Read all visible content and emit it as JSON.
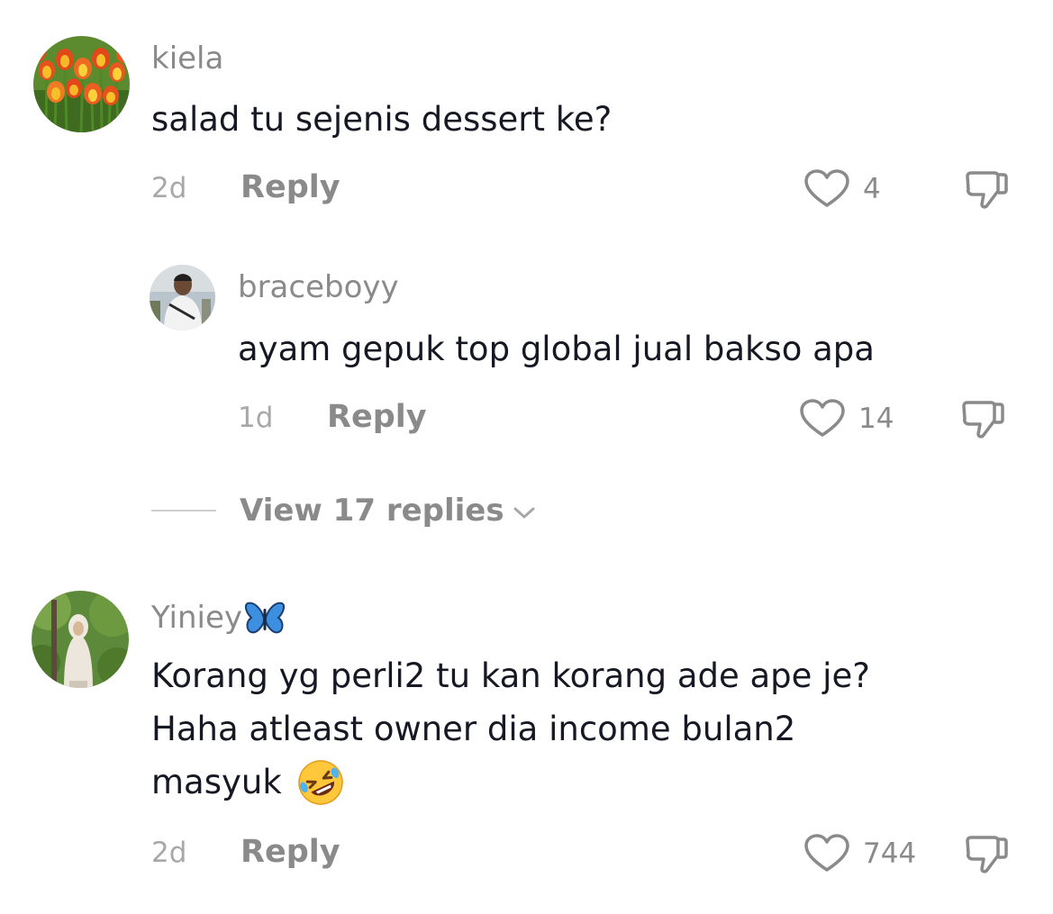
{
  "comments": [
    {
      "username": "kiela",
      "text": "salad tu sejenis dessert ke?",
      "time": "2d",
      "reply_label": "Reply",
      "likes": "4",
      "avatar_icon": "tulips-photo"
    },
    {
      "username": "braceboyy",
      "text": "ayam gepuk top global jual bakso apa",
      "time": "1d",
      "reply_label": "Reply",
      "likes": "14",
      "avatar_icon": "person-photo"
    },
    {
      "username": "Yiniey",
      "username_emoji": "butterfly-emoji",
      "text_lines": [
        "Korang yg perli2 tu kan korang ade ape je?",
        "Haha atleast owner dia income bulan2",
        "masyuk"
      ],
      "text_emoji": "rolling-on-floor-laughing-emoji",
      "time": "2d",
      "reply_label": "Reply",
      "likes": "744",
      "avatar_icon": "woman-in-garden-photo"
    }
  ],
  "view_replies": {
    "label": "View 17 replies"
  },
  "colors": {
    "primary_text": "#161823",
    "secondary_text": "#8a8a8a",
    "butterfly": "#3d8fe0"
  }
}
